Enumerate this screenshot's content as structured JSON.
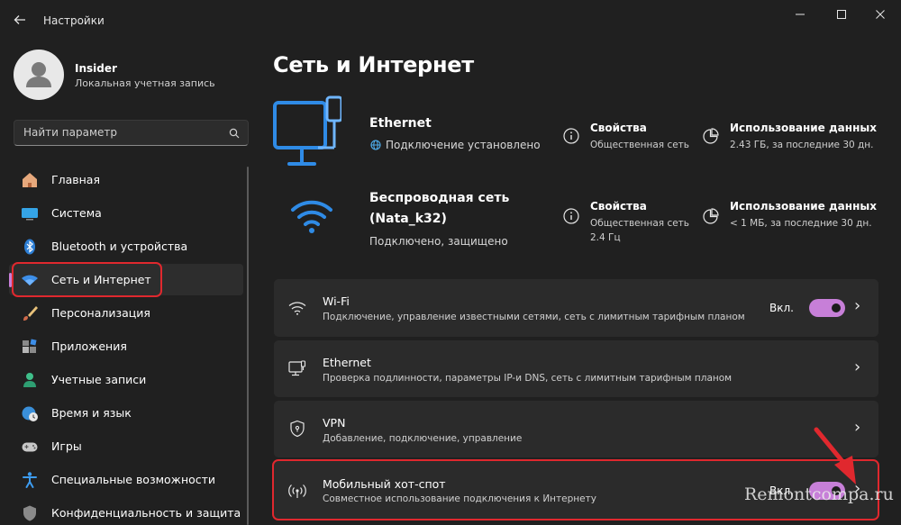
{
  "window": {
    "title": "Настройки"
  },
  "user": {
    "name": "Insider",
    "account_type": "Локальная учетная запись"
  },
  "search": {
    "placeholder": "Найти параметр"
  },
  "nav": [
    {
      "label": "Главная",
      "icon": "home-icon"
    },
    {
      "label": "Система",
      "icon": "monitor-icon"
    },
    {
      "label": "Bluetooth и устройства",
      "icon": "bluetooth-icon"
    },
    {
      "label": "Сеть и Интернет",
      "icon": "wifi-icon",
      "active": true
    },
    {
      "label": "Персонализация",
      "icon": "brush-icon"
    },
    {
      "label": "Приложения",
      "icon": "apps-icon"
    },
    {
      "label": "Учетные записи",
      "icon": "person-icon"
    },
    {
      "label": "Время и язык",
      "icon": "globe-clock-icon"
    },
    {
      "label": "Игры",
      "icon": "gamepad-icon"
    },
    {
      "label": "Специальные возможности",
      "icon": "accessibility-icon"
    },
    {
      "label": "Конфиденциальность и защита",
      "icon": "shield-icon"
    }
  ],
  "page": {
    "title": "Сеть и Интернет"
  },
  "status_cards": [
    {
      "name": "Ethernet",
      "status": "Подключение установлено",
      "props_title": "Свойства",
      "props_sub": "Общественная сеть",
      "usage_title": "Использование данных",
      "usage_sub": "2.43 ГБ, за последние 30 дн."
    },
    {
      "name_line1": "Беспроводная сеть",
      "name_line2": "(Nata_k32)",
      "status": "Подключено, защищено",
      "props_title": "Свойства",
      "props_sub_line1": "Общественная сеть",
      "props_sub_line2": "2.4 Гц",
      "usage_title": "Использование данных",
      "usage_sub": "< 1 МБ, за последние 30 дн."
    }
  ],
  "settings_rows": [
    {
      "title": "Wi-Fi",
      "subtitle": "Подключение, управление известными сетями, сеть с лимитным тарифным планом",
      "toggle_label": "Вкл.",
      "toggle_on": true
    },
    {
      "title": "Ethernet",
      "subtitle": "Проверка подлинности, параметры IP-и DNS, сеть с лимитным тарифным планом"
    },
    {
      "title": "VPN",
      "subtitle": "Добавление, подключение, управление"
    },
    {
      "title": "Мобильный хот-спот",
      "subtitle": "Совместное использование подключения к Интернету",
      "toggle_label": "Вкл.",
      "toggle_on": true
    }
  ],
  "watermark": "Remontcompa.ru",
  "colors": {
    "accent": "#c77fd8",
    "highlight_outline": "#e0282e",
    "ethernet_icon": "#4aa8ff",
    "background": "#202020"
  }
}
